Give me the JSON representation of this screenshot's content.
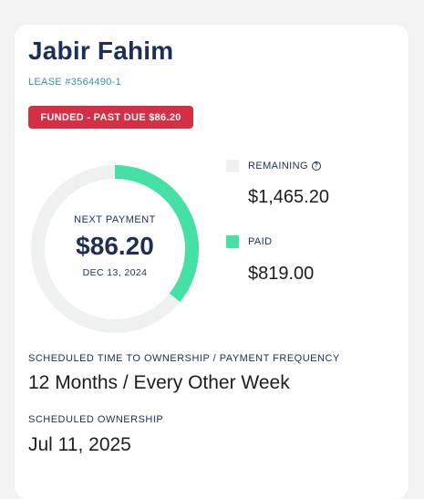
{
  "customer": {
    "name": "Jabir Fahim",
    "lease": "LEASE #3564490-1"
  },
  "status_badge": {
    "text": "FUNDED - PAST DUE $86.20",
    "color": "#d42f44"
  },
  "next_payment": {
    "label": "NEXT PAYMENT",
    "amount": "$86.20",
    "date": "DEC 13, 2024"
  },
  "chart_data": {
    "type": "pie",
    "categories": [
      "REMAINING",
      "PAID"
    ],
    "values": [
      1465.2,
      819.0
    ],
    "colors": [
      "#eff1f0",
      "#45e1a4"
    ]
  },
  "legend": {
    "remaining": {
      "label": "REMAINING",
      "value": "$1,465.20",
      "icon": "help-icon",
      "color": "#eff1f0"
    },
    "paid": {
      "label": "PAID",
      "value": "$819.00",
      "color": "#45e1a4"
    }
  },
  "schedule": {
    "ownership_frequency_label": "SCHEDULED TIME TO OWNERSHIP / PAYMENT FREQUENCY",
    "ownership_frequency_value": "12 Months / Every Other Week",
    "ownership_label": "SCHEDULED OWNERSHIP",
    "ownership_value": "Jul 11, 2025"
  }
}
